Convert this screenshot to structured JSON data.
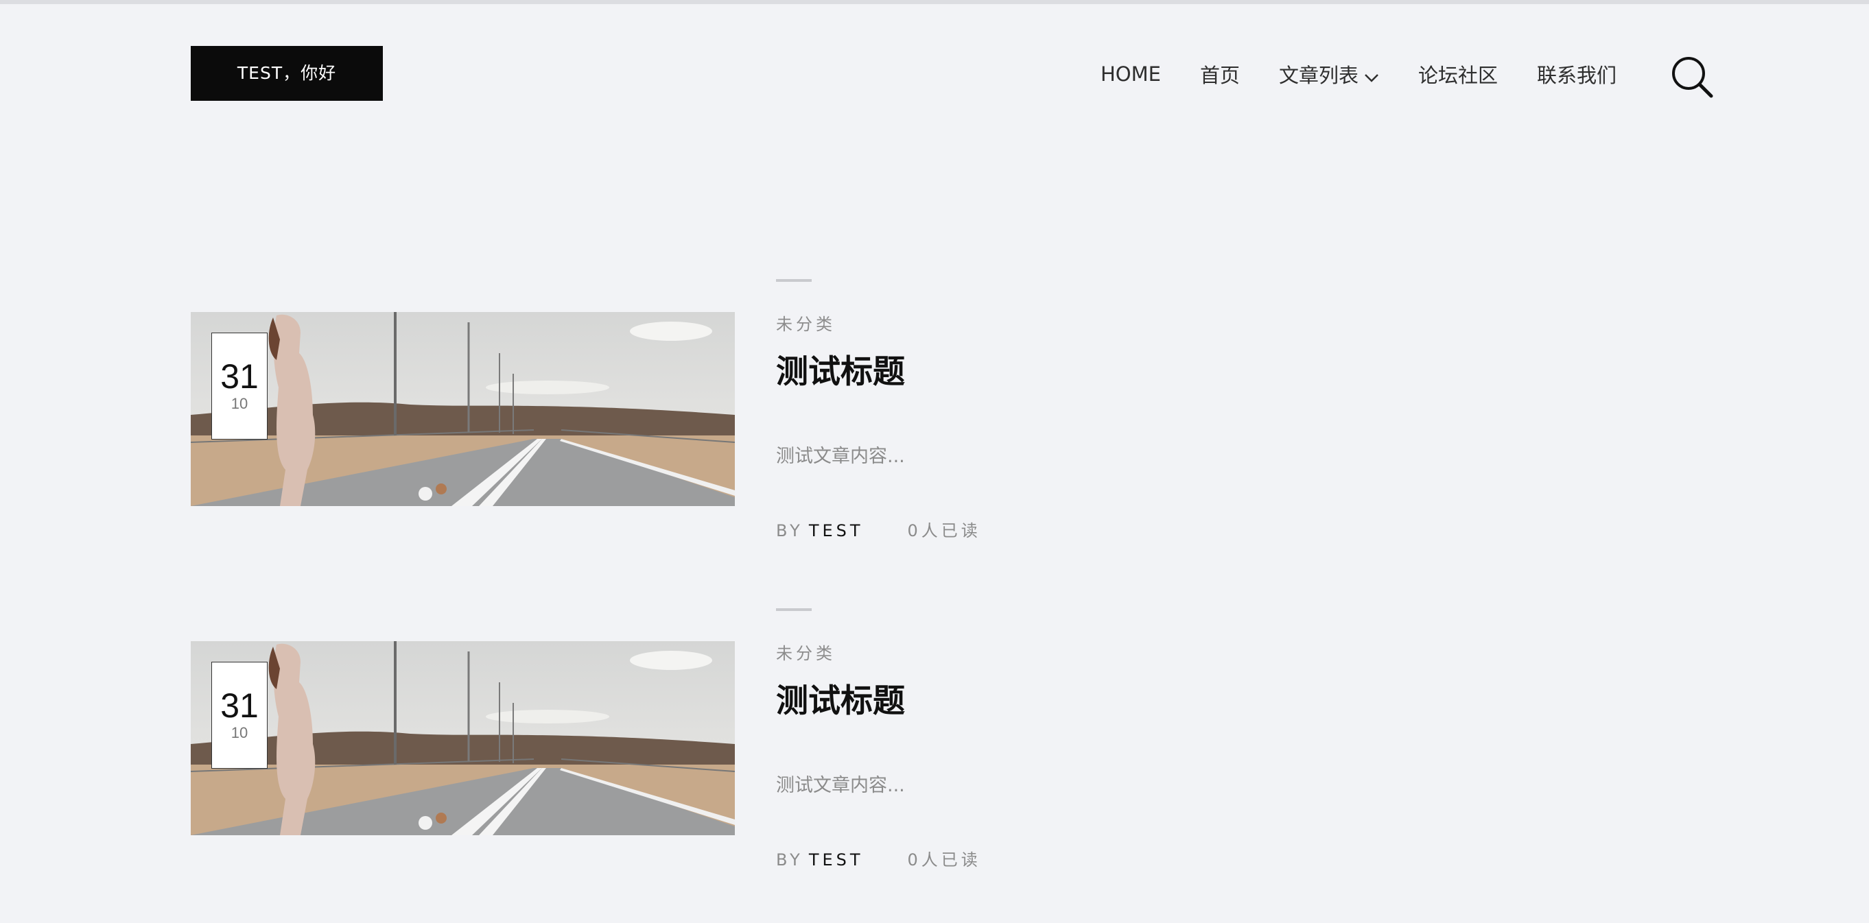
{
  "header": {
    "logo_text": "TEST，你好",
    "nav": [
      {
        "label": "HOME",
        "has_dropdown": false
      },
      {
        "label": "首页",
        "has_dropdown": false
      },
      {
        "label": "文章列表",
        "has_dropdown": true
      },
      {
        "label": "论坛社区",
        "has_dropdown": false
      },
      {
        "label": "联系我们",
        "has_dropdown": false
      }
    ],
    "search_icon": "search-icon"
  },
  "posts": [
    {
      "day": "31",
      "month": "10",
      "category": "未分类",
      "title": "测试标题",
      "excerpt": "测试文章内容...",
      "by_label": "BY",
      "author": "TEST",
      "reads": "0人已读"
    },
    {
      "day": "31",
      "month": "10",
      "category": "未分类",
      "title": "测试标题",
      "excerpt": "测试文章内容...",
      "by_label": "BY",
      "author": "TEST",
      "reads": "0人已读"
    }
  ],
  "colors": {
    "background": "#f2f3f6",
    "logo_bg": "#0b0b0b",
    "title": "#111111",
    "muted": "#8b8b8b"
  }
}
